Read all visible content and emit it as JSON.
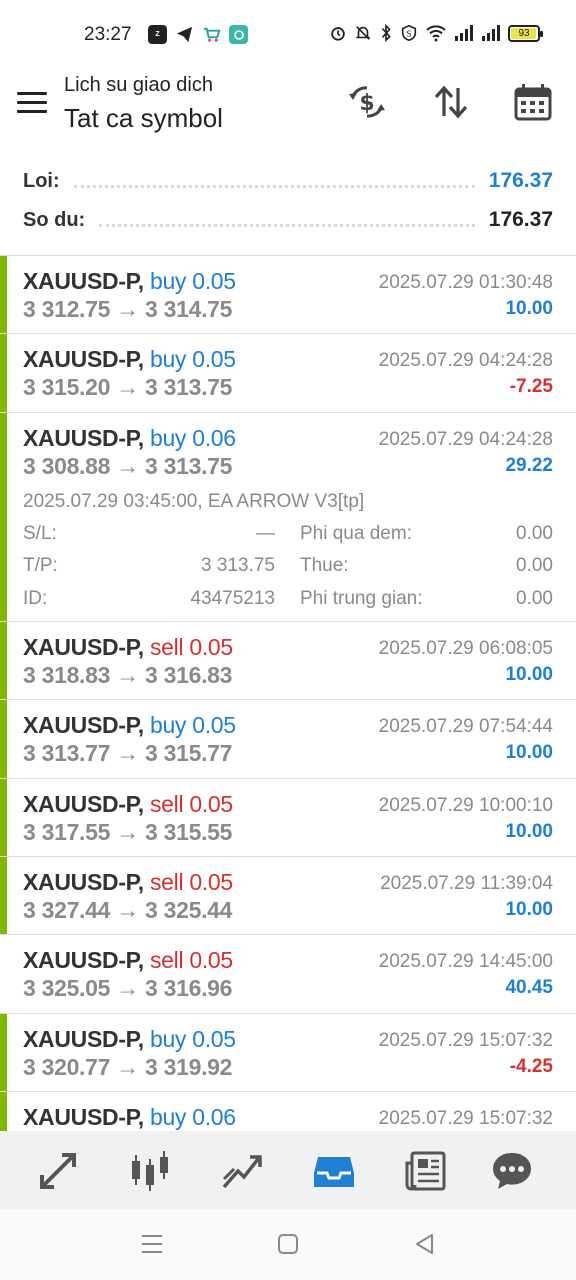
{
  "status_bar": {
    "time": "23:27",
    "battery": "93"
  },
  "header": {
    "subtitle": "Lich su giao dich",
    "title": "Tat ca symbol"
  },
  "summary": {
    "profit_label": "Loi:",
    "profit_value": "176.37",
    "balance_label": "So du:",
    "balance_value": "176.37"
  },
  "trades": [
    {
      "symbol": "XAUUSD-P,",
      "side": "buy 0.05",
      "type": "buy",
      "time": "2025.07.29 01:30:48",
      "prices": "3 312.75 → 3 314.75",
      "profit": "10.00",
      "sign": "pos",
      "bar": true
    },
    {
      "symbol": "XAUUSD-P,",
      "side": "buy 0.05",
      "type": "buy",
      "time": "2025.07.29 04:24:28",
      "prices": "3 315.20 → 3 313.75",
      "profit": "-7.25",
      "sign": "neg",
      "bar": true
    },
    {
      "symbol": "XAUUSD-P,",
      "side": "buy 0.06",
      "type": "buy",
      "time": "2025.07.29 04:24:28",
      "prices": "3 308.88 → 3 313.75",
      "profit": "29.22",
      "sign": "pos",
      "bar": true,
      "details": {
        "comment": "2025.07.29 03:45:00, EA ARROW V3[tp]",
        "sl_label": "S/L:",
        "sl_value": "—",
        "tp_label": "T/P:",
        "tp_value": "3 313.75",
        "id_label": "ID:",
        "id_value": "43475213",
        "swap_label": "Phi qua dem:",
        "swap_value": "0.00",
        "tax_label": "Thue:",
        "tax_value": "0.00",
        "fee_label": "Phi trung gian:",
        "fee_value": "0.00"
      }
    },
    {
      "symbol": "XAUUSD-P,",
      "side": "sell 0.05",
      "type": "sell",
      "time": "2025.07.29 06:08:05",
      "prices": "3 318.83 → 3 316.83",
      "profit": "10.00",
      "sign": "pos",
      "bar": true
    },
    {
      "symbol": "XAUUSD-P,",
      "side": "buy 0.05",
      "type": "buy",
      "time": "2025.07.29 07:54:44",
      "prices": "3 313.77 → 3 315.77",
      "profit": "10.00",
      "sign": "pos",
      "bar": true
    },
    {
      "symbol": "XAUUSD-P,",
      "side": "sell 0.05",
      "type": "sell",
      "time": "2025.07.29 10:00:10",
      "prices": "3 317.55 → 3 315.55",
      "profit": "10.00",
      "sign": "pos",
      "bar": true
    },
    {
      "symbol": "XAUUSD-P,",
      "side": "sell 0.05",
      "type": "sell",
      "time": "2025.07.29 11:39:04",
      "prices": "3 327.44 → 3 325.44",
      "profit": "10.00",
      "sign": "pos",
      "bar": true
    },
    {
      "symbol": "XAUUSD-P,",
      "side": "sell 0.05",
      "type": "sell",
      "time": "2025.07.29 14:45:00",
      "prices": "3 325.05 → 3 316.96",
      "profit": "40.45",
      "sign": "pos",
      "bar": false
    },
    {
      "symbol": "XAUUSD-P,",
      "side": "buy 0.05",
      "type": "buy",
      "time": "2025.07.29 15:07:32",
      "prices": "3 320.77 → 3 319.92",
      "profit": "-4.25",
      "sign": "neg",
      "bar": true
    },
    {
      "symbol": "XAUUSD-P,",
      "side": "buy 0.06",
      "type": "buy",
      "time": "2025.07.29 15:07:32",
      "prices": "",
      "profit": "",
      "sign": "pos",
      "bar": true
    }
  ],
  "nav_icons": [
    "trade-icon",
    "chart-icon",
    "analytics-icon",
    "history-inbox-icon",
    "news-icon",
    "chat-icon"
  ],
  "colors": {
    "accent": "#1e7fd3",
    "loss": "#d63131",
    "bar": "#7fba00"
  }
}
